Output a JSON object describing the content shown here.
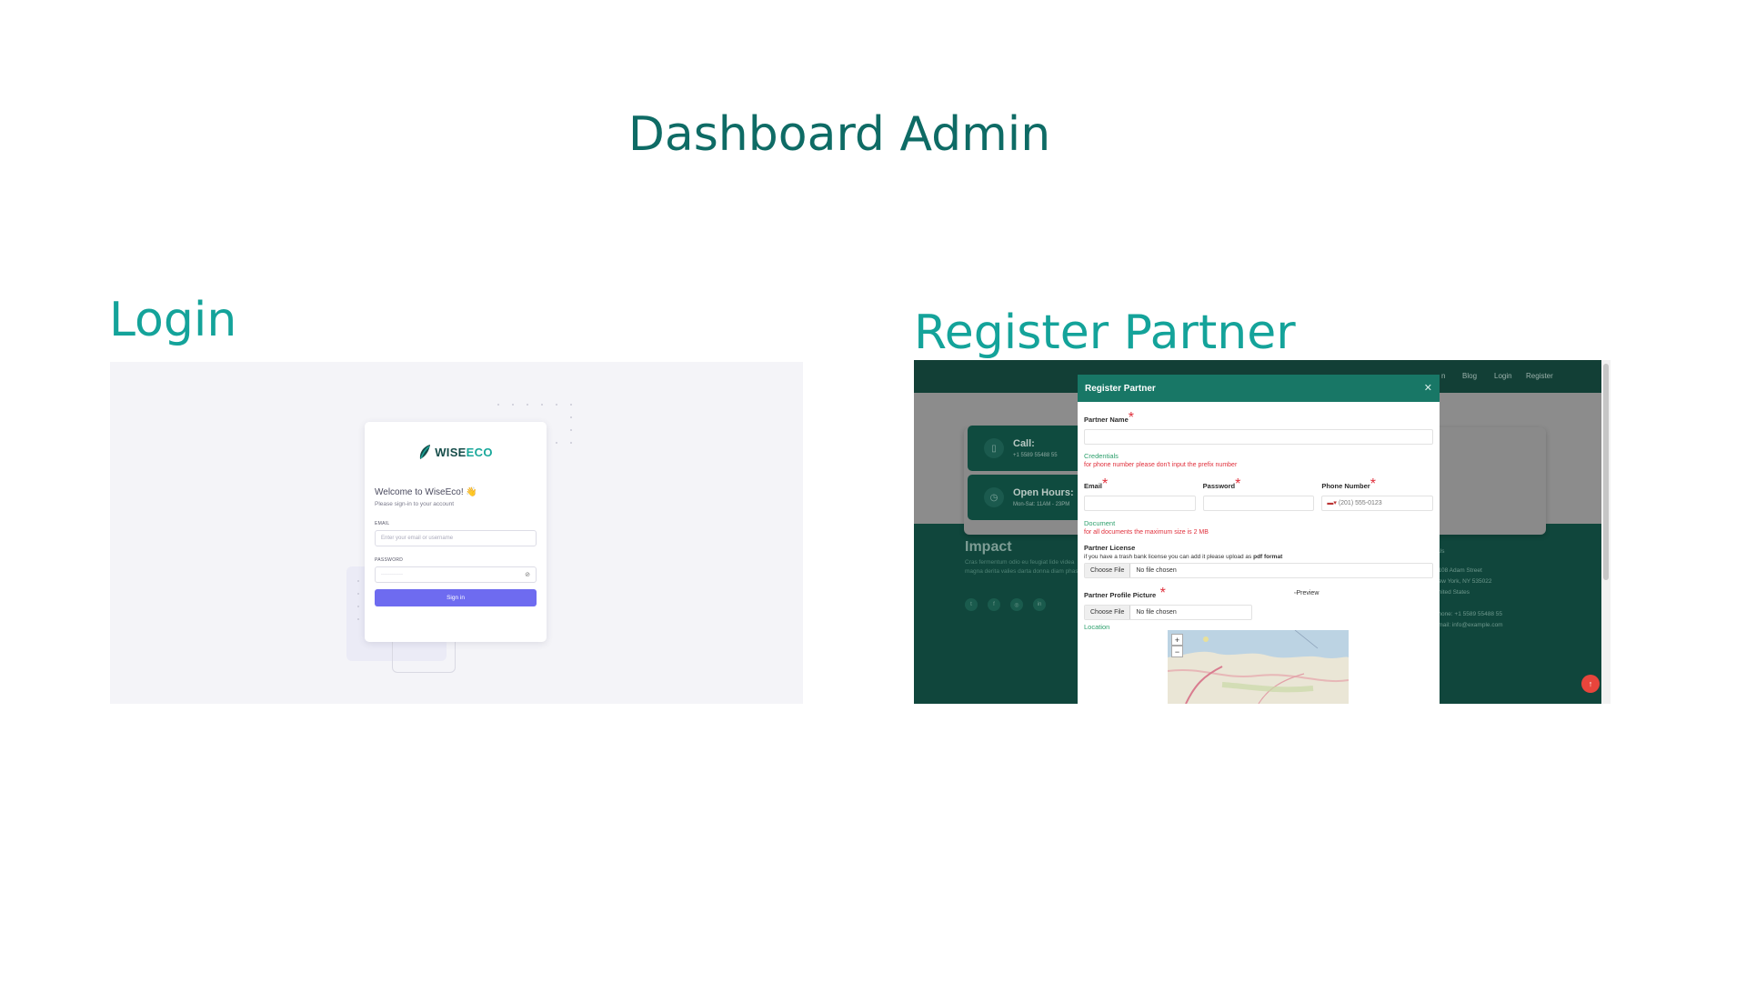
{
  "page": {
    "title": "Dashboard Admin",
    "login_heading": "Login",
    "register_heading": "Register Partner"
  },
  "login": {
    "brand_prefix": "WISE",
    "brand_suffix": "ECO",
    "welcome": "Welcome to WiseEco! 👋",
    "subtitle": "Please sign-in to your account",
    "email_label": "EMAIL",
    "email_placeholder": "Enter your email or username",
    "password_label": "PASSWORD",
    "password_mask": "············",
    "signin_label": "Sign in",
    "colors": {
      "button": "#6e6bf0",
      "brand": "#164d4a",
      "brand_accent": "#1aa89b"
    }
  },
  "register": {
    "nav": [
      "n",
      "Blog",
      "Login",
      "Register"
    ],
    "call_title": "Call:",
    "call_value": "+1 5589 55488 55",
    "hours_title": "Open Hours:",
    "hours_value": "Mon-Sat: 11AM - 23PM",
    "footer_title": "Impact",
    "footer_desc": "Cras fermentum odio eu feugiat lide videa magna derita valies darta donna diam phasellus.",
    "footer_right": [
      "A108 Adam Street",
      "New York, NY 535022",
      "United States",
      "",
      "Phone: +1 5589 55488 55",
      "Email: info@example.com"
    ],
    "modal": {
      "title": "Register Partner",
      "partner_name_label": "Partner Name",
      "credentials_label": "Credentials",
      "credentials_note": "for phone number please don't input the prefix number",
      "email_label": "Email",
      "password_label": "Password",
      "phone_label": "Phone Number",
      "phone_placeholder": "(201) 555-0123",
      "document_label": "Document",
      "document_note": "for all documents the maximum size is 2 MB",
      "license_label": "Partner License",
      "license_note_prefix": "if you have a trash bank license you can add it please upload as ",
      "license_note_bold": "pdf format",
      "choose_file": "Choose File",
      "no_file": "No file chosen",
      "profile_label": "Partner Profile Picture",
      "preview_alt": "Preview",
      "location_label": "Location",
      "zoom_in": "+",
      "zoom_out": "−"
    },
    "colors": {
      "header": "#187766",
      "background": "#10463c",
      "required": "#e0303c",
      "section": "#2ea06d"
    }
  }
}
